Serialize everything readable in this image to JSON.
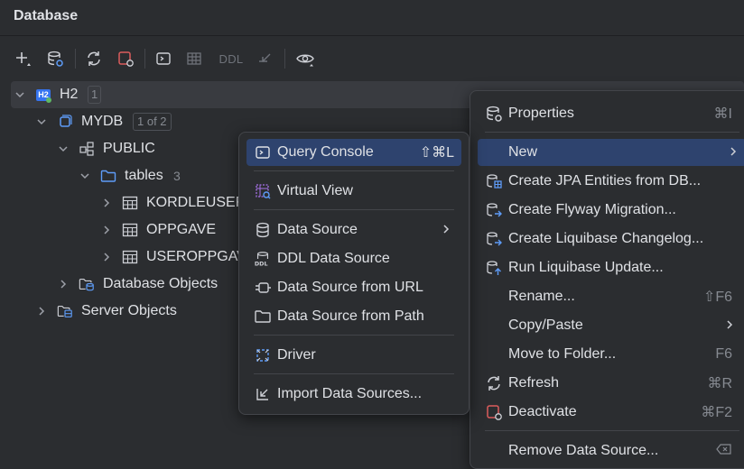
{
  "panel": {
    "title": "Database"
  },
  "toolbar": {
    "ddl_label": "DDL"
  },
  "tree": {
    "h2": {
      "label": "H2",
      "badge": "1",
      "icon_text": "H2"
    },
    "mydb": {
      "label": "MYDB",
      "badge": "1 of 2"
    },
    "public": {
      "label": "PUBLIC"
    },
    "tables": {
      "label": "tables",
      "count": "3"
    },
    "t1": {
      "label": "KORDLEUSER"
    },
    "t2": {
      "label": "OPPGAVE"
    },
    "t3": {
      "label": "USEROPPGAVE"
    },
    "dbobjects": {
      "label": "Database Objects"
    },
    "serverobjects": {
      "label": "Server Objects"
    }
  },
  "submenu": {
    "items": [
      {
        "label": "Query Console",
        "shortcut": "⇧⌘L"
      },
      {
        "label": "Virtual View"
      },
      {
        "label": "Data Source"
      },
      {
        "label": "DDL Data Source"
      },
      {
        "label": "Data Source from URL"
      },
      {
        "label": "Data Source from Path"
      },
      {
        "label": "Driver"
      },
      {
        "label": "Import Data Sources..."
      }
    ]
  },
  "context_menu": {
    "items": [
      {
        "label": "Properties",
        "shortcut": "⌘I"
      },
      {
        "label": "New"
      },
      {
        "label": "Create JPA Entities from DB..."
      },
      {
        "label": "Create Flyway Migration..."
      },
      {
        "label": "Create Liquibase Changelog..."
      },
      {
        "label": "Run Liquibase Update..."
      },
      {
        "label": "Rename...",
        "shortcut": "⇧F6"
      },
      {
        "label": "Copy/Paste"
      },
      {
        "label": "Move to Folder...",
        "shortcut": "F6"
      },
      {
        "label": "Refresh",
        "shortcut": "⌘R"
      },
      {
        "label": "Deactivate",
        "shortcut": "⌘F2"
      },
      {
        "label": "Remove Data Source..."
      }
    ]
  },
  "colors": {
    "accent": "#3574f0",
    "highlight": "#2e436e",
    "background": "#2b2d30",
    "deactivate": "#db5c5c"
  }
}
